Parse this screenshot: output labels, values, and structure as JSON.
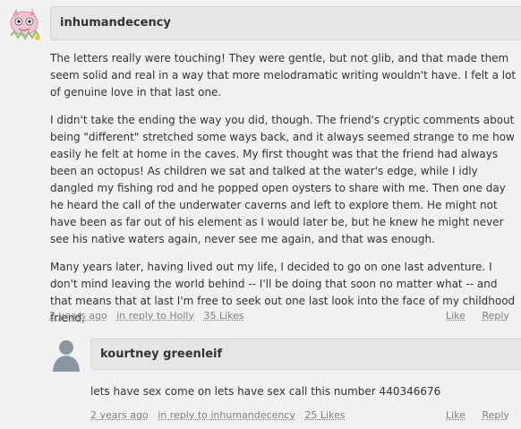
{
  "comment1": {
    "author": "inhumandecency",
    "paragraphs": [
      "The letters really were touching! They were gentle, but not glib, and that made them seem solid and real in a way that more melodramatic writing wouldn't have. I felt a lot of genuine love in that last one.",
      "I didn't take the ending the way you did, though. The friend's cryptic comments about being \"different\" stretched some ways back, and it always seemed strange to me how easily he felt at home in the caves. My first thought was that the friend had always been an octopus! As children we sat and talked at the water's edge, while I idly dangled my fishing rod and he popped open oysters to share with me. Then one day he heard the call of the underwater caverns and left to explore them. He might not have been as far out of his element as I would later be, but he knew he might never see his native waters again, never see me again, and that was enough.",
      "Many years later, having lived out my life, I decided to go on one last adventure. I don't mind leaving the world behind -- I'll be doing that soon no matter what -- and that means that at last I'm free to seek out one last look into the face of my childhood friend,"
    ],
    "time": "2 years ago",
    "reply_to": "in reply to Holly",
    "likes": "35 Likes",
    "like_label": "Like",
    "reply_label": "Reply"
  },
  "comment2": {
    "author": "kourtney greenleif",
    "text": "lets have sex come on lets have sex call this number 440346676",
    "time": "2 years ago",
    "reply_to": "in reply to inhumandecency",
    "likes": "25 Likes",
    "like_label": "Like",
    "reply_label": "Reply"
  },
  "icons": {
    "avatar1": "cartoon-creature-avatar-icon",
    "avatar2": "default-person-silhouette-icon"
  }
}
